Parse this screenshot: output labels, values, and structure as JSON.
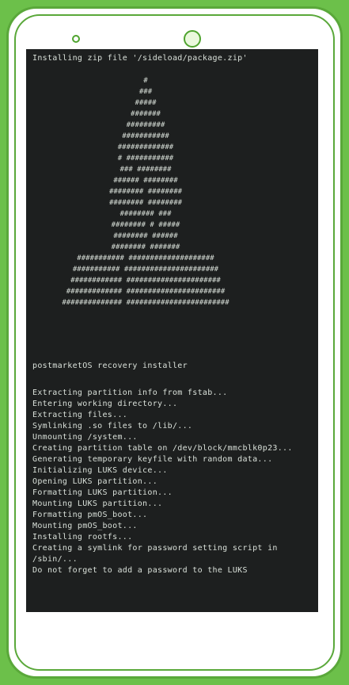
{
  "header_line": "Installing zip file '/sideload/package.zip'",
  "title_line": "postmarketOS recovery installer",
  "log_lines": [
    "Extracting partition info from fstab...",
    "Entering working directory...",
    "Extracting files...",
    "Symlinking .so files to /lib/...",
    "Unmounting /system...",
    "Creating partition table on /dev/block/mmcblk0p23...",
    "Generating temporary keyfile with random data...",
    "Initializing LUKS device...",
    "Opening LUKS partition...",
    "Formatting LUKS partition...",
    "Mounting LUKS partition...",
    "Formatting pmOS_boot...",
    "Mounting pmOS_boot...",
    "Installing rootfs...",
    "Creating a symlink for password setting script in",
    "/sbin/...",
    "Do not forget to add a password to the LUKS"
  ],
  "colors": {
    "frame_green": "#6cc04a",
    "screen_bg": "#1d1f1f",
    "text": "#d9e0d9",
    "scrollbar": "#1ea4de"
  },
  "icons": [
    "speaker-icon",
    "camera-icon",
    "postmarketos-logo"
  ]
}
